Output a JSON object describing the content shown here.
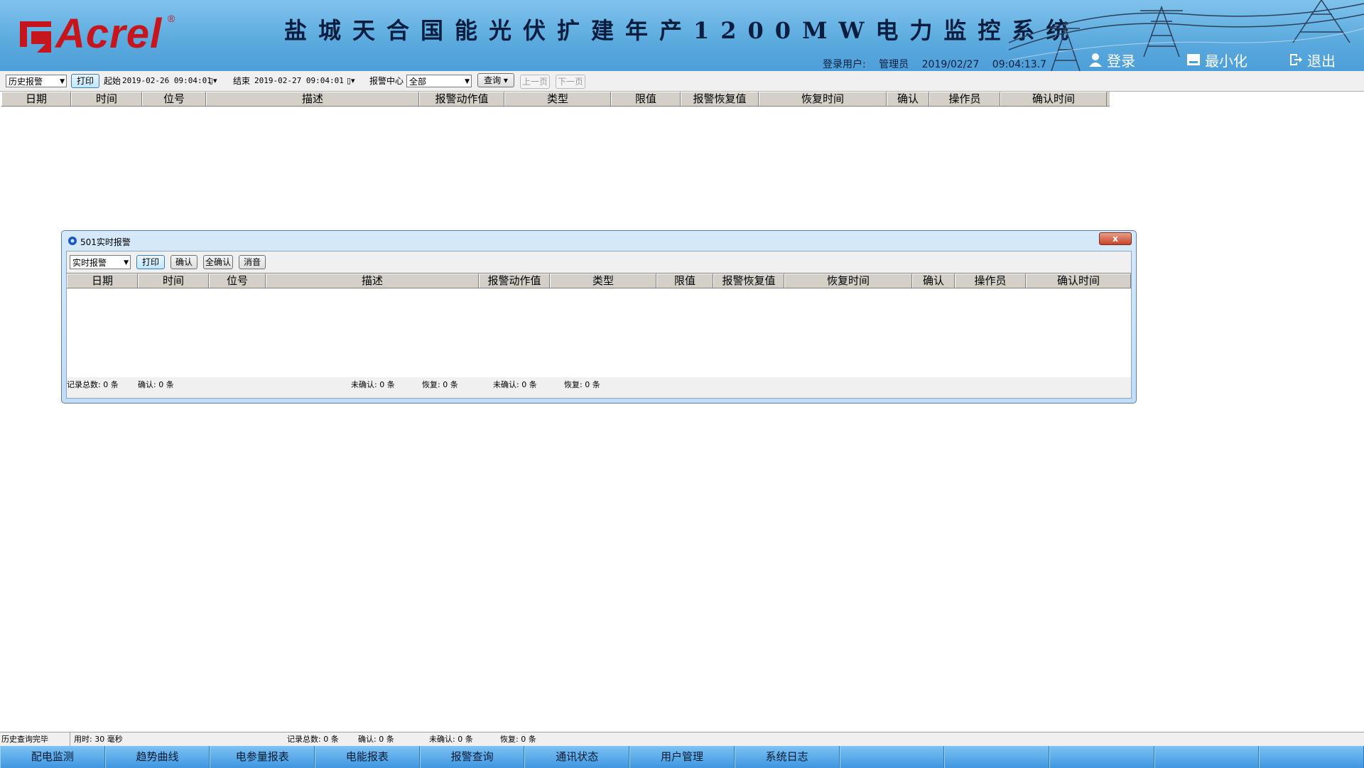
{
  "header": {
    "logo_text": "Acrel",
    "logo_reg": "®",
    "system_title": "盐城天合国能光伏扩建年产1200MW电力监控系统",
    "user_label": "登录用户:",
    "user_name": "管理员",
    "date": "2019/02/27",
    "time": "09:04:13.7",
    "login_label": "登录",
    "minimize_label": "最小化",
    "exit_label": "退出"
  },
  "toolbar": {
    "mode_value": "历史报警",
    "print_label": "打印",
    "start_label": "起始",
    "start_value": "2019-02-26  09:04:01",
    "end_label": "结束",
    "end_value": "2019-02-27  09:04:01",
    "center_label": "报警中心",
    "center_value": "全部",
    "query_label": "查询",
    "prev_label": "上一页",
    "next_label": "下一页"
  },
  "table": {
    "columns": [
      "日期",
      "时间",
      "位号",
      "描述",
      "报警动作值",
      "类型",
      "限值",
      "报警恢复值",
      "恢复时间",
      "确认",
      "操作员",
      "确认时间"
    ]
  },
  "popup": {
    "title": "501实时报警",
    "close_label": "x",
    "mode_value": "实时报警",
    "buttons": [
      "打印",
      "确认",
      "全确认",
      "消音"
    ],
    "columns": [
      "日期",
      "时间",
      "位号",
      "描述",
      "报警动作值",
      "类型",
      "限值",
      "报警恢复值",
      "恢复时间",
      "确认",
      "操作员",
      "确认时间"
    ],
    "status": {
      "total": "记录总数: 0 条",
      "confirmed": "确认: 0 条",
      "unconfirmed": "未确认: 0 条",
      "recovered": "恢复: 0 条",
      "unconfirmed2": "未确认: 0 条",
      "recovered2": "恢复: 0 条"
    }
  },
  "statusbar": {
    "query_done": "历史查询完毕",
    "elapsed": "用时: 30 毫秒",
    "total": "记录总数: 0 条",
    "confirmed": "确认: 0 条",
    "unconfirmed": "未确认: 0 条",
    "recovered": "恢复: 0 条"
  },
  "nav": {
    "items": [
      "配电监测",
      "趋势曲线",
      "电参量报表",
      "电能报表",
      "报警查询",
      "通讯状态",
      "用户管理",
      "系统日志",
      "",
      "",
      "",
      "",
      ""
    ]
  }
}
